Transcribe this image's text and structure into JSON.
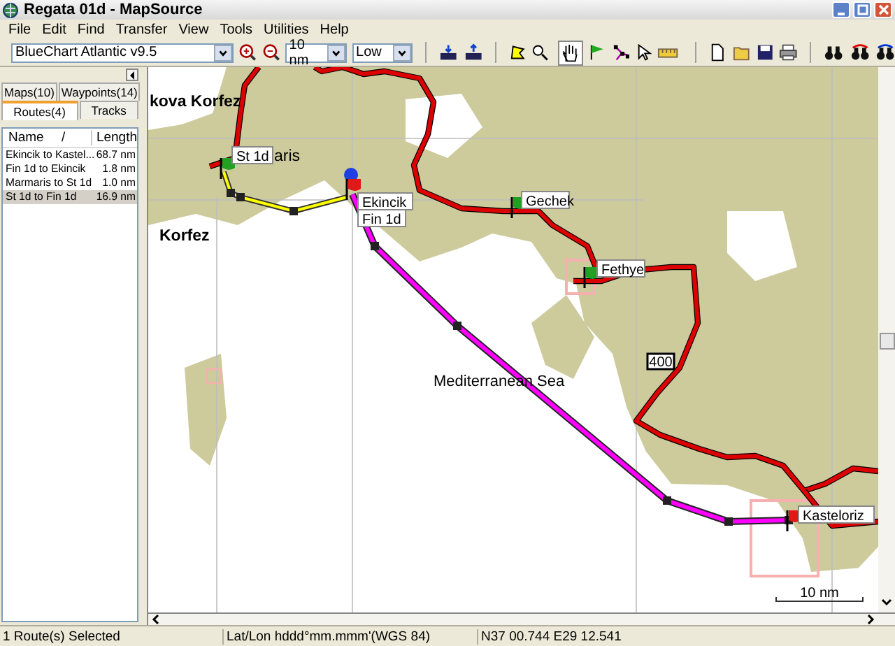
{
  "window": {
    "title": "Regata 01d - MapSource"
  },
  "menu": [
    "File",
    "Edit",
    "Find",
    "Transfer",
    "View",
    "Tools",
    "Utilities",
    "Help"
  ],
  "toolbar": {
    "map_product": "BlueChart Atlantic v9.5",
    "zoom": "10 nm",
    "detail": "Low"
  },
  "sidebar": {
    "tabs": [
      {
        "label": "Maps(10)",
        "selected": false
      },
      {
        "label": "Waypoints(14)",
        "selected": false
      },
      {
        "label": "Routes(4)",
        "selected": true
      },
      {
        "label": "Tracks",
        "selected": false
      }
    ],
    "table": {
      "columns": [
        "Name",
        "/",
        "Length"
      ],
      "rows": [
        {
          "name": "Ekincik to Kastel...",
          "length": "68.7 nm",
          "selected": false
        },
        {
          "name": "Fin 1d to Ekincik",
          "length": "1.8 nm",
          "selected": false
        },
        {
          "name": "Marmaris to St 1d",
          "length": "1.0 nm",
          "selected": false
        },
        {
          "name": "St 1d to Fin 1d",
          "length": "16.9 nm",
          "selected": true
        }
      ]
    }
  },
  "map": {
    "place_labels": [
      "kova Korfez",
      "Korfez",
      "aris",
      "Mediterranean Sea"
    ],
    "waypoints": [
      {
        "name": "St 1d",
        "kind": "flag",
        "color": "#22a022"
      },
      {
        "name": "Ekincik",
        "kind": "dot",
        "color": "#1f3fe0"
      },
      {
        "name": "Fin 1d",
        "kind": "flag",
        "color": "#e01818"
      },
      {
        "name": "Gechek",
        "kind": "flag",
        "color": "#22a022"
      },
      {
        "name": "Fethye",
        "kind": "flag",
        "color": "#22a022"
      },
      {
        "name": "Kasteloriz",
        "kind": "flag",
        "color": "#e01818"
      }
    ],
    "road_shield": "400",
    "scale": "10 nm"
  },
  "status_bar": [
    "1 Route(s) Selected",
    "Lat/Lon hddd°mm.mmm'(WGS 84)",
    "N37 00.744 E29 12.541"
  ]
}
